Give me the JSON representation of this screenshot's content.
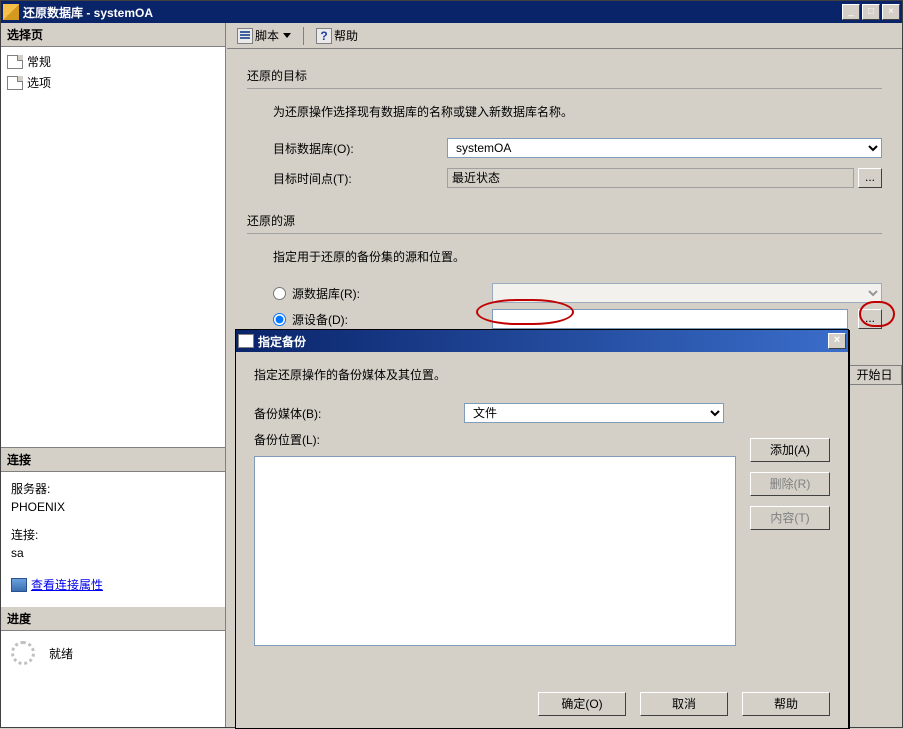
{
  "window": {
    "title": "还原数据库 - systemOA"
  },
  "left": {
    "select_page_header": "选择页",
    "general": "常规",
    "options": "选项",
    "connection_header": "连接",
    "server_label": "服务器:",
    "server_value": "PHOENIX",
    "conn_label": "连接:",
    "conn_value": "sa",
    "view_props": "查看连接属性",
    "progress_header": "进度",
    "ready": "就绪"
  },
  "toolbar": {
    "script": "脚本",
    "help": "帮助"
  },
  "form": {
    "dest_title": "还原的目标",
    "dest_help": "为还原操作选择现有数据库的名称或键入新数据库名称。",
    "target_db_label": "目标数据库(O):",
    "target_db_value": "systemOA",
    "target_time_label": "目标时间点(T):",
    "target_time_value": "最近状态",
    "src_title": "还原的源",
    "src_help": "指定用于还原的备份集的源和位置。",
    "radio_db": "源数据库(R):",
    "radio_dev": "源设备(D):",
    "ellipsis": "...",
    "grid_col": "开始日"
  },
  "modal": {
    "title": "指定备份",
    "desc": "指定还原操作的备份媒体及其位置。",
    "media_label": "备份媒体(B):",
    "media_value": "文件",
    "location_label": "备份位置(L):",
    "add": "添加(A)",
    "remove": "删除(R)",
    "contents": "内容(T)",
    "ok": "确定(O)",
    "cancel": "取消",
    "help2": "帮助"
  }
}
